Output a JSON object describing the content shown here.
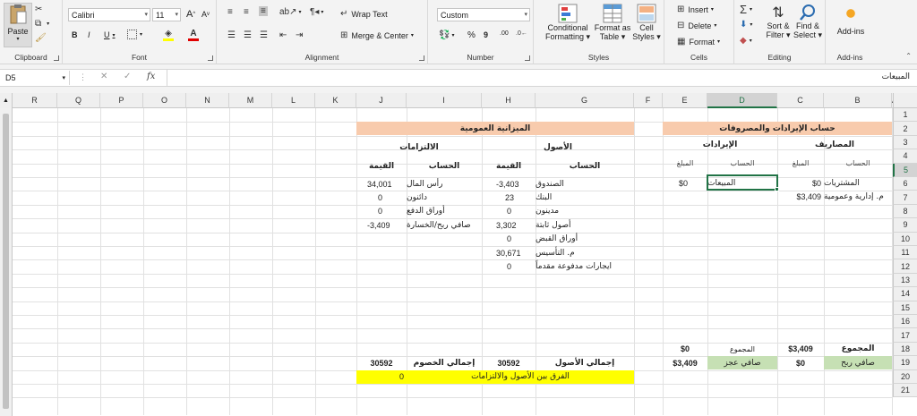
{
  "ribbon": {
    "clipboard": {
      "paste": "Paste",
      "label": "Clipboard"
    },
    "font": {
      "name": "Calibri",
      "size": "11",
      "bold": "B",
      "italic": "I",
      "underline": "U",
      "grow": "A",
      "shrink": "A",
      "label": "Font"
    },
    "alignment": {
      "wrap": "Wrap Text",
      "merge": "Merge & Center",
      "label": "Alignment"
    },
    "number": {
      "format": "Custom",
      "percent": "%",
      "comma": "9",
      "inc": ".00",
      "label": "Number"
    },
    "styles": {
      "conditional1": "Conditional",
      "conditional2": "Formatting",
      "table1": "Format as",
      "table2": "Table",
      "cell1": "Cell",
      "cell2": "Styles",
      "label": "Styles"
    },
    "cells": {
      "insert": "Insert",
      "delete": "Delete",
      "format": "Format",
      "label": "Cells"
    },
    "editing": {
      "sort1": "Sort &",
      "sort2": "Filter",
      "find1": "Find &",
      "find2": "Select",
      "label": "Editing"
    },
    "addins": {
      "btn": "Add-ins",
      "label": "Add-ins"
    }
  },
  "formula_bar": {
    "name_box": "D5",
    "fx": "fx",
    "value": "المبيعات"
  },
  "columns": [
    "R",
    "Q",
    "P",
    "O",
    "N",
    "M",
    "L",
    "K",
    "J",
    "I",
    "H",
    "G",
    "F",
    "E",
    "D",
    "C",
    "B",
    "A"
  ],
  "rows": [
    "1",
    "2",
    "3",
    "4",
    "5",
    "6",
    "7",
    "8",
    "9",
    "10",
    "11",
    "12",
    "13",
    "14",
    "15",
    "16",
    "17",
    "18",
    "19",
    "20",
    "21"
  ],
  "income": {
    "title": "حساب الإيرادات والمصروفات",
    "expenses_header": "المصاريف",
    "revenues_header": "الإيرادات",
    "account_label": "الحساب",
    "amount_label": "المبلغ",
    "expenses": [
      {
        "account": "المشتريات",
        "amount": "$0"
      },
      {
        "account": "م. إدارية وعمومية",
        "amount": "$3,409"
      }
    ],
    "revenues": [
      {
        "account": "المبيعات",
        "amount": "$0"
      }
    ],
    "total_label": "المجموع",
    "total_expenses": "$3,409",
    "total_revenues": "$0",
    "net_profit_label": "صافي ربح",
    "net_profit": "$0",
    "net_loss_label": "صافي عجز",
    "net_loss": "$3,409"
  },
  "balance": {
    "title": "الميزانية العمومية",
    "assets_header": "الأصول",
    "liabilities_header": "الالتزامات",
    "account_label": "الحساب",
    "value_label": "القيمة",
    "assets": [
      {
        "account": "الصندوق",
        "value": "-3,403"
      },
      {
        "account": "البنك",
        "value": "23"
      },
      {
        "account": "مدينون",
        "value": "0"
      },
      {
        "account": "أصول ثابتة",
        "value": "3,302"
      },
      {
        "account": "أوراق القبض",
        "value": "0"
      },
      {
        "account": "م. التأسيس",
        "value": "30,671"
      },
      {
        "account": "ايجارات مدفوعة مقدماً",
        "value": "0"
      }
    ],
    "liabilities": [
      {
        "account": "رأس المال",
        "value": "34,001"
      },
      {
        "account": "دائنون",
        "value": "0"
      },
      {
        "account": "أوراق الدفع",
        "value": "0"
      },
      {
        "account": "صافي ربح/الخسارة",
        "value": "-3,409"
      }
    ],
    "total_assets_label": "إجمالي الأصول",
    "total_assets": "30592",
    "total_liabilities_label": "إجمالي الخصوم",
    "total_liabilities": "30592",
    "diff_label": "الفرق بين الأصول والالتزامات",
    "diff_value": "0"
  },
  "colors": {
    "orange": "#f8cbad",
    "green": "#c6e0b4",
    "yellow": "#ffff00",
    "selection": "#217346"
  }
}
